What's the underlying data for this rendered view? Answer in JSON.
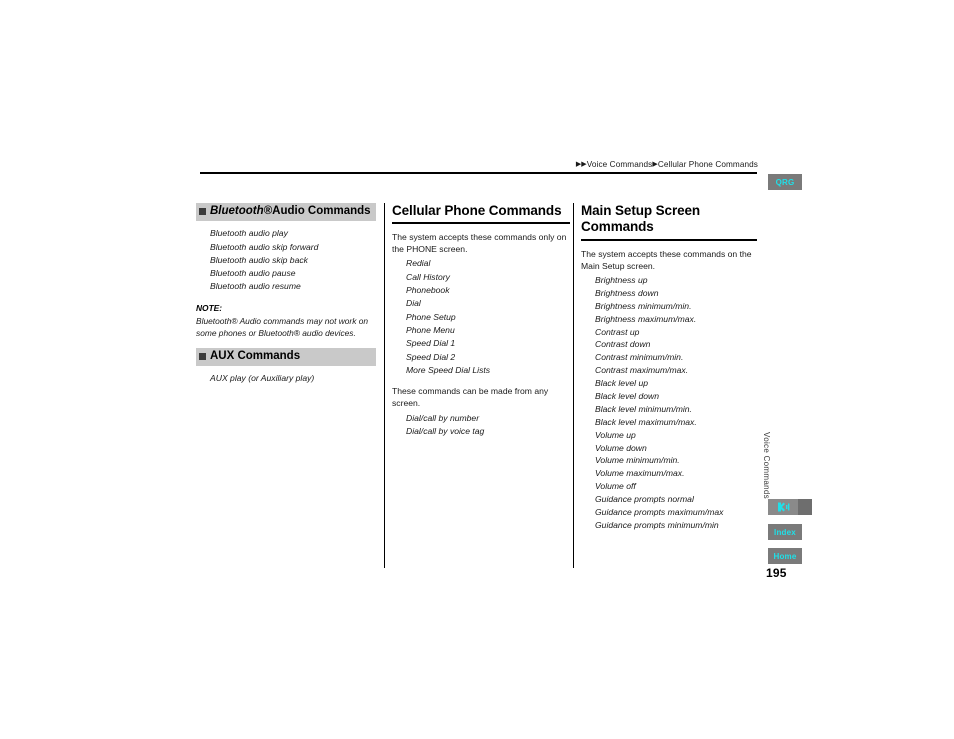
{
  "breadcrumb": {
    "arrow": "▶",
    "level1": "Voice Commands",
    "level2": "Cellular Phone Commands"
  },
  "tabs": {
    "qrg": "QRG",
    "index": "Index",
    "home": "Home",
    "icon_name": "voice-commands-icon"
  },
  "side_label": "Voice Commands",
  "page_number": "195",
  "colors": {
    "tab_background": "#7a7a7a",
    "tab_text": "#1fe0e8",
    "heading_bar": "#c9c9c9",
    "bullet_square": "#3b3b3b"
  },
  "left_column": {
    "section1": {
      "heading_italic": "Bluetooth®",
      "heading_rest": " Audio Commands",
      "commands": [
        "Bluetooth audio play",
        "Bluetooth audio skip forward",
        "Bluetooth audio skip back",
        "Bluetooth audio pause",
        "Bluetooth audio resume"
      ]
    },
    "note": {
      "label": "NOTE:",
      "text": "Bluetooth® Audio commands may not work on some phones or Bluetooth® audio devices."
    },
    "section2": {
      "heading": "AUX Commands",
      "commands": [
        "AUX play (or Auxiliary play)"
      ]
    }
  },
  "middle_column": {
    "heading": "Cellular Phone Commands",
    "intro1": "The system accepts these commands only on the PHONE screen.",
    "commands1": [
      "Redial",
      "Call History",
      "Phonebook",
      "Dial",
      "Phone Setup",
      "Phone Menu",
      "Speed Dial 1",
      "Speed Dial 2",
      "More Speed Dial Lists"
    ],
    "intro2": "These commands can be made from any screen.",
    "commands2": [
      "Dial/call by number",
      "Dial/call by voice tag"
    ]
  },
  "right_column": {
    "heading": "Main Setup Screen Commands",
    "intro": "The system accepts these commands on the Main Setup screen.",
    "commands": [
      "Brightness up",
      "Brightness down",
      "Brightness minimum/min.",
      "Brightness maximum/max.",
      "Contrast up",
      "Contrast down",
      "Contrast minimum/min.",
      "Contrast maximum/max.",
      "Black level up",
      "Black level down",
      "Black level minimum/min.",
      "Black level maximum/max.",
      "Volume up",
      "Volume down",
      "Volume minimum/min.",
      "Volume maximum/max.",
      "Volume off",
      "Guidance prompts normal",
      "Guidance prompts maximum/max",
      "Guidance prompts minimum/min"
    ]
  }
}
